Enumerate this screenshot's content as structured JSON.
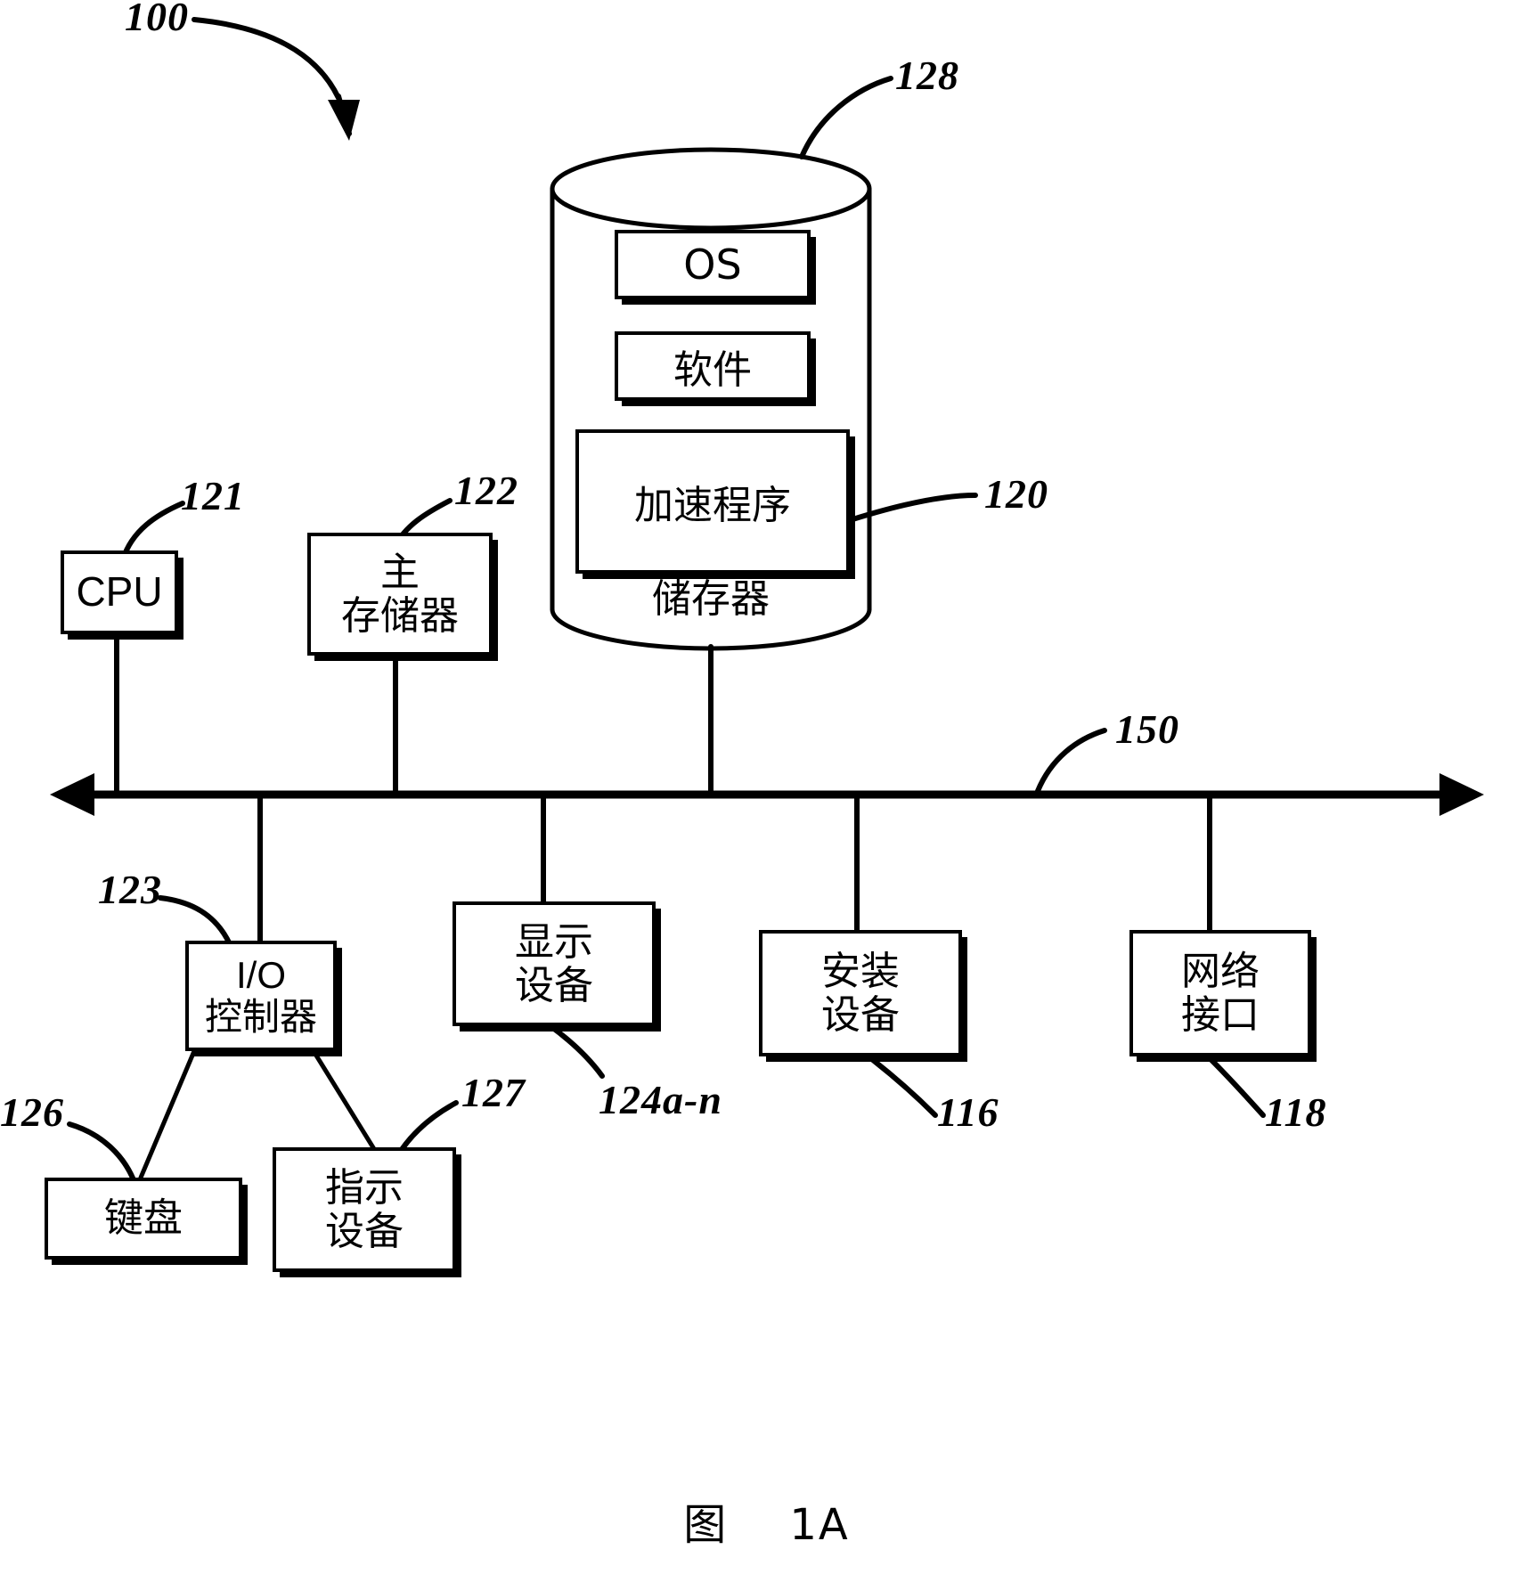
{
  "figure": {
    "caption_label": "图",
    "caption_number": "1A",
    "caption_full": "图    1A",
    "system_ref": "100"
  },
  "storage": {
    "ref": "128",
    "label": "储存器",
    "contents": [
      {
        "name": "os",
        "label": "OS",
        "ref": null
      },
      {
        "name": "software",
        "label": "软件",
        "ref": null
      },
      {
        "name": "accelerator",
        "label": "加速程序",
        "ref": "120"
      }
    ]
  },
  "bus": {
    "ref": "150",
    "name": "system-bus"
  },
  "blocks": [
    {
      "name": "cpu",
      "ref": "121",
      "lines": [
        "CPU"
      ],
      "latin": true
    },
    {
      "name": "main-memory",
      "ref": "122",
      "lines": [
        "主",
        "存储器"
      ],
      "latin": false
    },
    {
      "name": "io-controller",
      "ref": "123",
      "lines": [
        "I/O",
        "控制器"
      ],
      "latin": false
    },
    {
      "name": "display-device",
      "ref": "124a-n",
      "lines": [
        "显示",
        "设备"
      ],
      "latin": false
    },
    {
      "name": "install-device",
      "ref": "116",
      "lines": [
        "安装",
        "设备"
      ],
      "latin": false
    },
    {
      "name": "network-interface",
      "ref": "118",
      "lines": [
        "网络",
        "接口"
      ],
      "latin": false
    },
    {
      "name": "keyboard",
      "ref": "126",
      "lines": [
        "键盘"
      ],
      "latin": false
    },
    {
      "name": "pointing-device",
      "ref": "127",
      "lines": [
        "指示",
        "设备"
      ],
      "latin": false
    }
  ],
  "colors": {
    "ink": "#000000",
    "paper": "#ffffff"
  }
}
